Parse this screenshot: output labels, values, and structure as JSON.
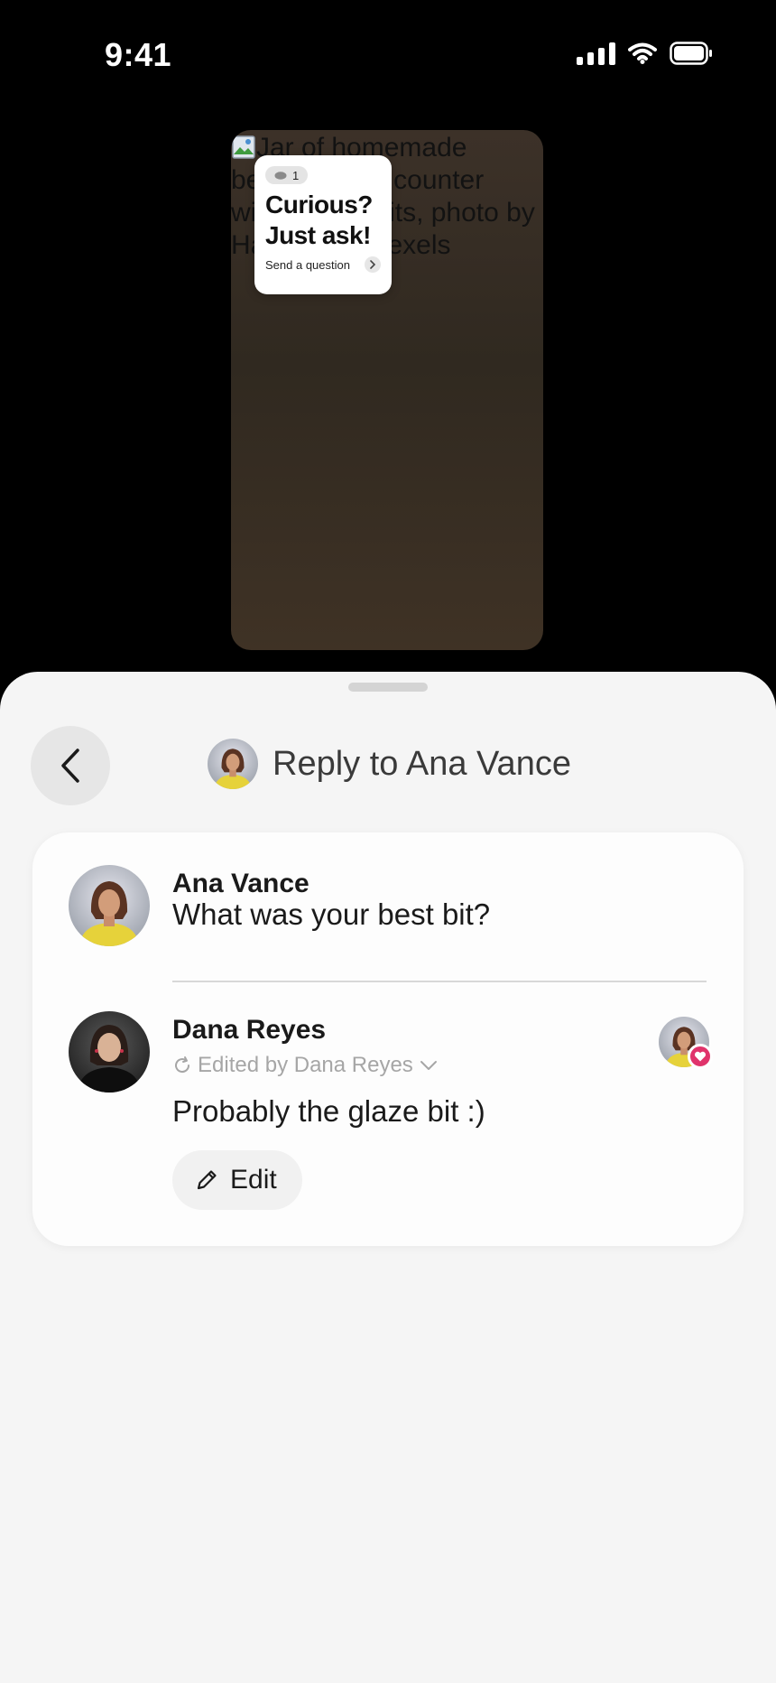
{
  "status_bar": {
    "time": "9:41"
  },
  "story": {
    "alt_text": "Jar of homemade beehive on a counter with spice fruits, photo by Hannka on Pexels",
    "sticker": {
      "view_count": "1",
      "title_line1": "Curious?",
      "title_line2": "Just ask!",
      "cta": "Send a question"
    }
  },
  "sheet": {
    "header_title": "Reply to Ana Vance",
    "question": {
      "author": "Ana Vance",
      "text": "What was your best bit?"
    },
    "reply": {
      "author": "Dana Reyes",
      "edited_label": "Edited by Dana Reyes",
      "text": "Probably the glaze bit :)",
      "edit_label": "Edit"
    }
  },
  "colors": {
    "heart_badge": "#e0336b",
    "sheet_bg": "#f5f5f5",
    "story_bg": "#3a3026"
  },
  "icons": [
    "signal-icon",
    "wifi-icon",
    "battery-icon",
    "eye-icon",
    "chevron-right-icon",
    "chevron-left-icon",
    "refresh-icon",
    "chevron-down-icon",
    "heart-icon",
    "pencil-icon"
  ]
}
